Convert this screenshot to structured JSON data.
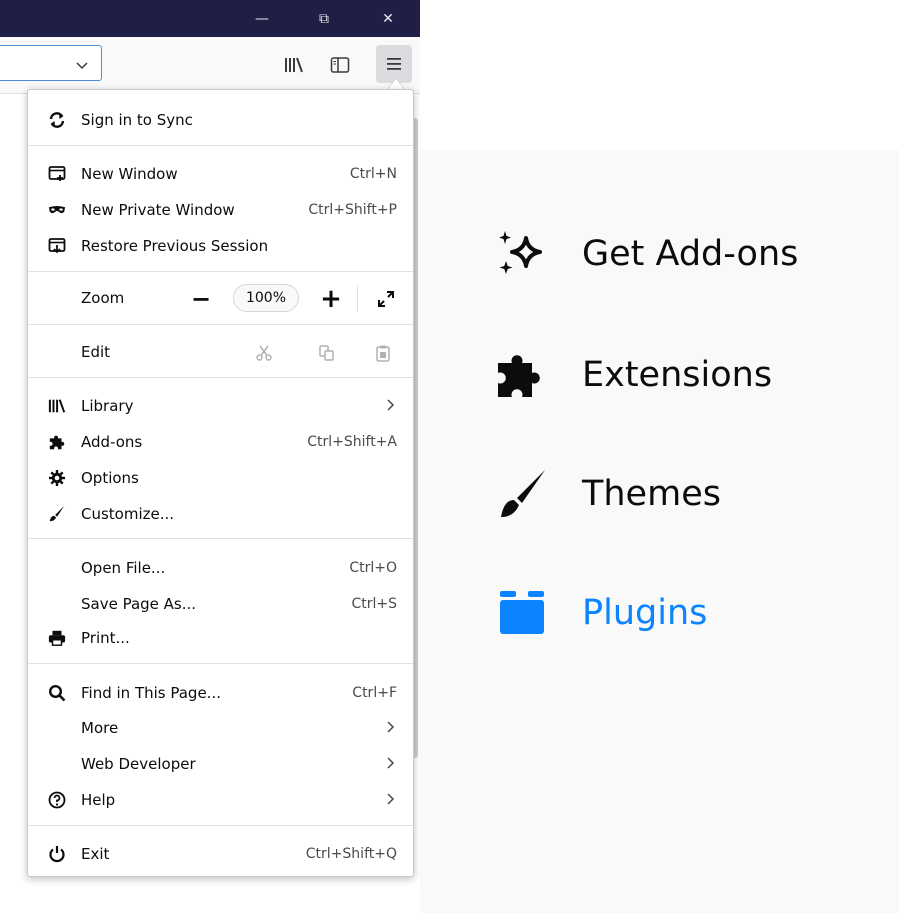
{
  "titlebar": {
    "buttons": [
      {
        "name": "minimize",
        "glyph": "—"
      },
      {
        "name": "restore",
        "glyph": "⧉"
      },
      {
        "name": "close",
        "glyph": "✕"
      }
    ]
  },
  "toolbar": {
    "url_dropdown_glyph": "⌄",
    "icons": [
      "library-icon",
      "sidebar-icon",
      "hamburger-menu-icon"
    ]
  },
  "menu": {
    "sync": {
      "label": "Sign in to Sync",
      "icon": "sync-icon"
    },
    "new_window": {
      "label": "New Window",
      "shortcut": "Ctrl+N",
      "icon": "new-window-icon"
    },
    "new_private_window": {
      "label": "New Private Window",
      "shortcut": "Ctrl+Shift+P",
      "icon": "private-mask-icon"
    },
    "restore_session": {
      "label": "Restore Previous Session",
      "icon": "restore-session-icon"
    },
    "zoom": {
      "label": "Zoom",
      "minus": "−",
      "level": "100%",
      "plus": "+",
      "fullscreen_icon": "fullscreen-icon"
    },
    "edit": {
      "label": "Edit",
      "icons": [
        "cut-icon",
        "copy-icon",
        "paste-icon"
      ]
    },
    "library": {
      "label": "Library",
      "icon": "library-icon",
      "chevron": "›"
    },
    "addons": {
      "label": "Add-ons",
      "shortcut": "Ctrl+Shift+A",
      "icon": "puzzle-icon"
    },
    "options": {
      "label": "Options",
      "icon": "gear-icon"
    },
    "customize": {
      "label": "Customize...",
      "icon": "paintbrush-icon"
    },
    "open_file": {
      "label": "Open File...",
      "shortcut": "Ctrl+O"
    },
    "save_page": {
      "label": "Save Page As...",
      "shortcut": "Ctrl+S"
    },
    "print": {
      "label": "Print...",
      "icon": "printer-icon"
    },
    "find": {
      "label": "Find in This Page...",
      "shortcut": "Ctrl+F",
      "icon": "search-icon"
    },
    "more": {
      "label": "More",
      "chevron": "›"
    },
    "web_developer": {
      "label": "Web Developer",
      "chevron": "›"
    },
    "help": {
      "label": "Help",
      "icon": "help-icon",
      "chevron": "›"
    },
    "exit": {
      "label": "Exit",
      "shortcut": "Ctrl+Shift+Q",
      "icon": "power-icon"
    }
  },
  "addons_sidebar": {
    "categories": [
      {
        "label": "Get Add-ons",
        "icon": "sparkle-icon",
        "selected": false
      },
      {
        "label": "Extensions",
        "icon": "puzzle-icon",
        "selected": false
      },
      {
        "label": "Themes",
        "icon": "paintbrush-icon",
        "selected": false
      },
      {
        "label": "Plugins",
        "icon": "plugin-icon",
        "selected": true
      }
    ],
    "accent_color": "#0a84ff"
  },
  "colors": {
    "titlebar": "#1f1e44",
    "menu_bg": "#ffffff",
    "sidebar_bg": "#f9f9fa",
    "text": "#0c0c0d"
  }
}
